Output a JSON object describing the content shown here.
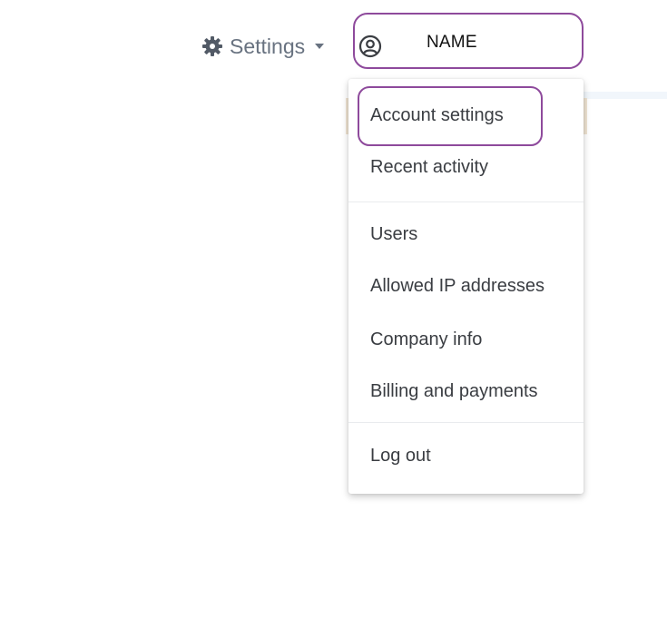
{
  "header": {
    "settings_label": "Settings",
    "settings_icon": "gear-icon",
    "user_icon": "user-circle-icon",
    "user_name": "NAME"
  },
  "menu": {
    "items": [
      {
        "label": "Account settings"
      },
      {
        "label": "Recent activity"
      },
      {
        "label": "Users"
      },
      {
        "label": "Allowed IP addresses"
      },
      {
        "label": "Company info"
      },
      {
        "label": "Billing and payments"
      },
      {
        "label": "Log out"
      }
    ]
  },
  "colors": {
    "highlight": "#8e4a9c",
    "text": "#3a3d42",
    "muted": "#687280"
  }
}
